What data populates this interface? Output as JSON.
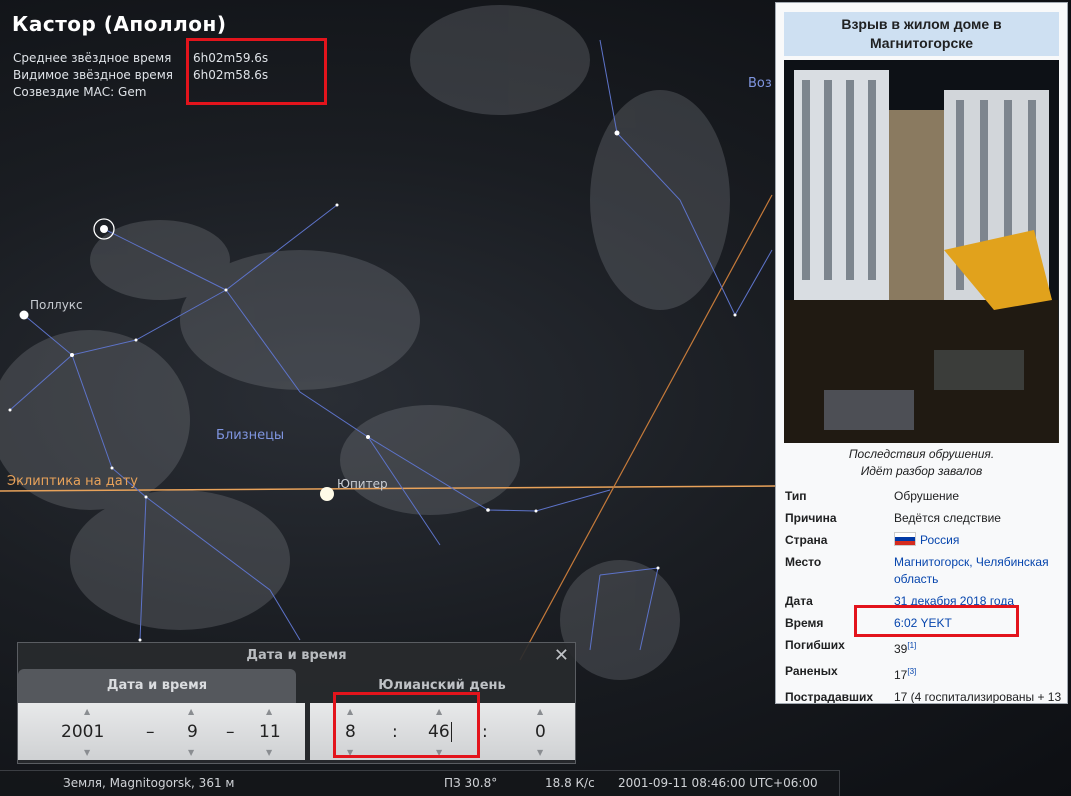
{
  "object": {
    "title": "Кастор (Аполлон)",
    "rows": [
      {
        "label": "Среднее звёздное время",
        "value": "6h02m59.6s"
      },
      {
        "label": "Видимое звёздное время",
        "value": "6h02m58.6s"
      },
      {
        "label": "Созвездие МАС: Gem",
        "value": ""
      }
    ]
  },
  "sky_labels": {
    "pollux": "Поллукс",
    "gemini": "Близнецы",
    "ecliptic": "Эклиптика на дату",
    "jupiter": "Юпитер",
    "partial": "Воз"
  },
  "wiki": {
    "title": "Взрыв в жилом доме в Магнитогорске",
    "caption_line1": "Последствия обрушения.",
    "caption_line2": "Идёт разбор завалов",
    "rows": [
      {
        "key": "Тип",
        "value": "Обрушение"
      },
      {
        "key": "Причина",
        "value": "Ведётся следствие"
      },
      {
        "key": "Страна",
        "value": "Россия"
      },
      {
        "key": "Место",
        "value": "Магнитогорск, Челябинская область"
      },
      {
        "key": "Дата",
        "value": "31 декабря 2018 года"
      },
      {
        "key": "Время",
        "value": "6:02 YEKT"
      },
      {
        "key": "Погибших",
        "value": "39",
        "ref": "[1]"
      },
      {
        "key": "Раненых",
        "value": "17",
        "ref": "[3]"
      },
      {
        "key": "Пострадавших",
        "value": "17 (4 госпитализированы + 13"
      }
    ]
  },
  "datetime_dialog": {
    "header": "Дата и время",
    "close": "✕",
    "tab_date": "Дата и время",
    "tab_jd": "Юлианский день",
    "year": "2001",
    "month": "9",
    "day": "11",
    "hour": "8",
    "minute": "46",
    "second": "0",
    "dash": "–",
    "colon": ":"
  },
  "status_bar": {
    "location": "Земля, Magnitogorsk, 361 м",
    "fov": "ПЗ 30.8°",
    "fps": "18.8 К/с",
    "datetime": "2001-09-11 08:46:00 UTC+06:00"
  },
  "colors": {
    "highlight_box": "#e3141c",
    "ecliptic": "#e8a25a",
    "constellation_lines": "#5d73c9"
  }
}
